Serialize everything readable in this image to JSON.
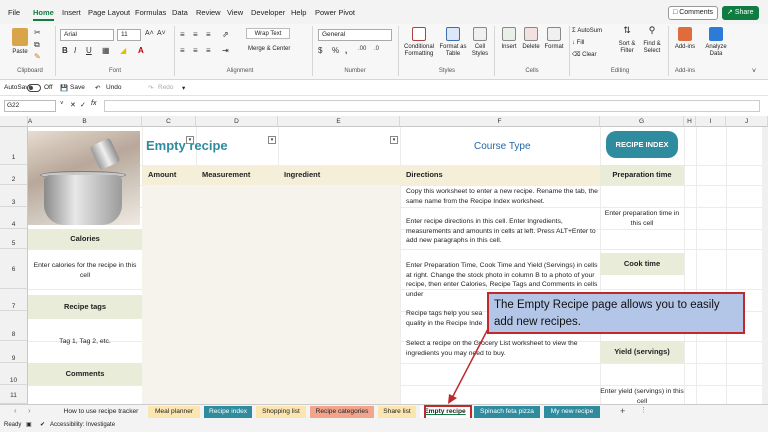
{
  "menu": {
    "tabs": [
      "File",
      "Home",
      "Insert",
      "Page Layout",
      "Formulas",
      "Data",
      "Review",
      "View",
      "Developer",
      "Help",
      "Power Pivot"
    ],
    "comments_label": "Comments",
    "share_label": "Share"
  },
  "ribbon": {
    "paste_label": "Paste",
    "font_name": "Arial",
    "font_size": "11",
    "wrap_text_label": "Wrap Text",
    "merge_center_label": "Merge & Center",
    "number_format": "General",
    "conditional_formatting_label": "Conditional Formatting",
    "format_as_table_label": "Format as Table",
    "cell_styles_label": "Cell Styles",
    "insert_label": "Insert",
    "delete_label": "Delete",
    "format_label": "Format",
    "autosum_label": "AutoSum",
    "fill_label": "Fill",
    "clear_label": "Clear",
    "sort_filter_label": "Sort & Filter",
    "find_select_label": "Find & Select",
    "addins_label": "Add-ins",
    "analyze_data_label": "Analyze Data",
    "groups": {
      "clipboard": "Clipboard",
      "font": "Font",
      "alignment": "Alignment",
      "number": "Number",
      "styles": "Styles",
      "cells": "Cells",
      "editing": "Editing",
      "addins": "Add-ins"
    }
  },
  "qat": {
    "autosave_label": "AutoSave",
    "autosave_state": "Off",
    "save_label": "Save",
    "undo_label": "Undo",
    "redo_label": "Redo"
  },
  "formula_bar": {
    "name_box": "G22",
    "fx": "fx",
    "content": ""
  },
  "columns": [
    "A",
    "B",
    "C",
    "D",
    "E",
    "F",
    "G",
    "H",
    "I",
    "J"
  ],
  "rows": [
    "1",
    "2",
    "3",
    "4",
    "5",
    "6",
    "7",
    "8",
    "9",
    "10",
    "11"
  ],
  "sheet": {
    "title": "Empty recipe",
    "course_type": "Course Type",
    "recipe_index_button": "RECIPE INDEX",
    "headers": {
      "amount": "Amount",
      "measurement": "Measurement",
      "ingredient": "Ingredient",
      "directions": "Directions"
    },
    "left_labels": {
      "calories": "Calories",
      "calories_text": "Enter calories for the recipe in this cell",
      "recipe_tags": "Recipe tags",
      "tags_text": "Tag 1, Tag 2, etc.",
      "comments": "Comments"
    },
    "right_labels": {
      "prep_time": "Preparation time",
      "prep_text": "Enter preparation time in this cell",
      "cook_time": "Cook time",
      "yield": "Yield (servings)",
      "yield_text": "Enter yield (servings) in this cell"
    },
    "directions": [
      "Copy this worksheet to enter a new recipe. Rename the tab, the same name from the Recipe Index worksheet.",
      "Enter recipe directions in this cell. Enter Ingredients, measurements and amounts in cells at left. Press ALT+Enter to add new paragraphs in this cell.",
      "Enter Preparation Time, Cook Time and Yield (Servings) in cells at right. Change the stock photo in column B to a photo of your recipe, then enter Calories, Recipe Tags and Comments in cells under",
      "Recipe tags help you sea quality in the Recipe Inde",
      "Select a recipe on the Grocery List worksheet to view the ingredients you may need to buy."
    ]
  },
  "callout": {
    "text": "The Empty Recipe page allows you to easily add new recipes."
  },
  "sheet_tabs": [
    {
      "label": "How to use recipe tracker",
      "color": "#f3f3f3",
      "text": "#222"
    },
    {
      "label": "Meal planner",
      "color": "#fbe5b0",
      "text": "#222"
    },
    {
      "label": "Recipe index",
      "color": "#2e8c9e",
      "text": "#fff"
    },
    {
      "label": "Shopping list",
      "color": "#fbe5b0",
      "text": "#222"
    },
    {
      "label": "Recipe categories",
      "color": "#f2a58c",
      "text": "#222"
    },
    {
      "label": "Share list",
      "color": "#fbe5b0",
      "text": "#222"
    },
    {
      "label": "Empty recipe",
      "color": "#ffffff",
      "text": "#222"
    },
    {
      "label": "Spinach feta pizza",
      "color": "#2e8c9e",
      "text": "#fff"
    },
    {
      "label": "My new recipe",
      "color": "#2e8c9e",
      "text": "#fff"
    }
  ],
  "status": {
    "ready": "Ready",
    "accessibility": "Accessibility: Investigate"
  },
  "colors": {
    "accent": "#107c41",
    "teal": "#2e8c9e",
    "callout_border": "#c0282a",
    "callout_fill": "#b4c6e7"
  }
}
